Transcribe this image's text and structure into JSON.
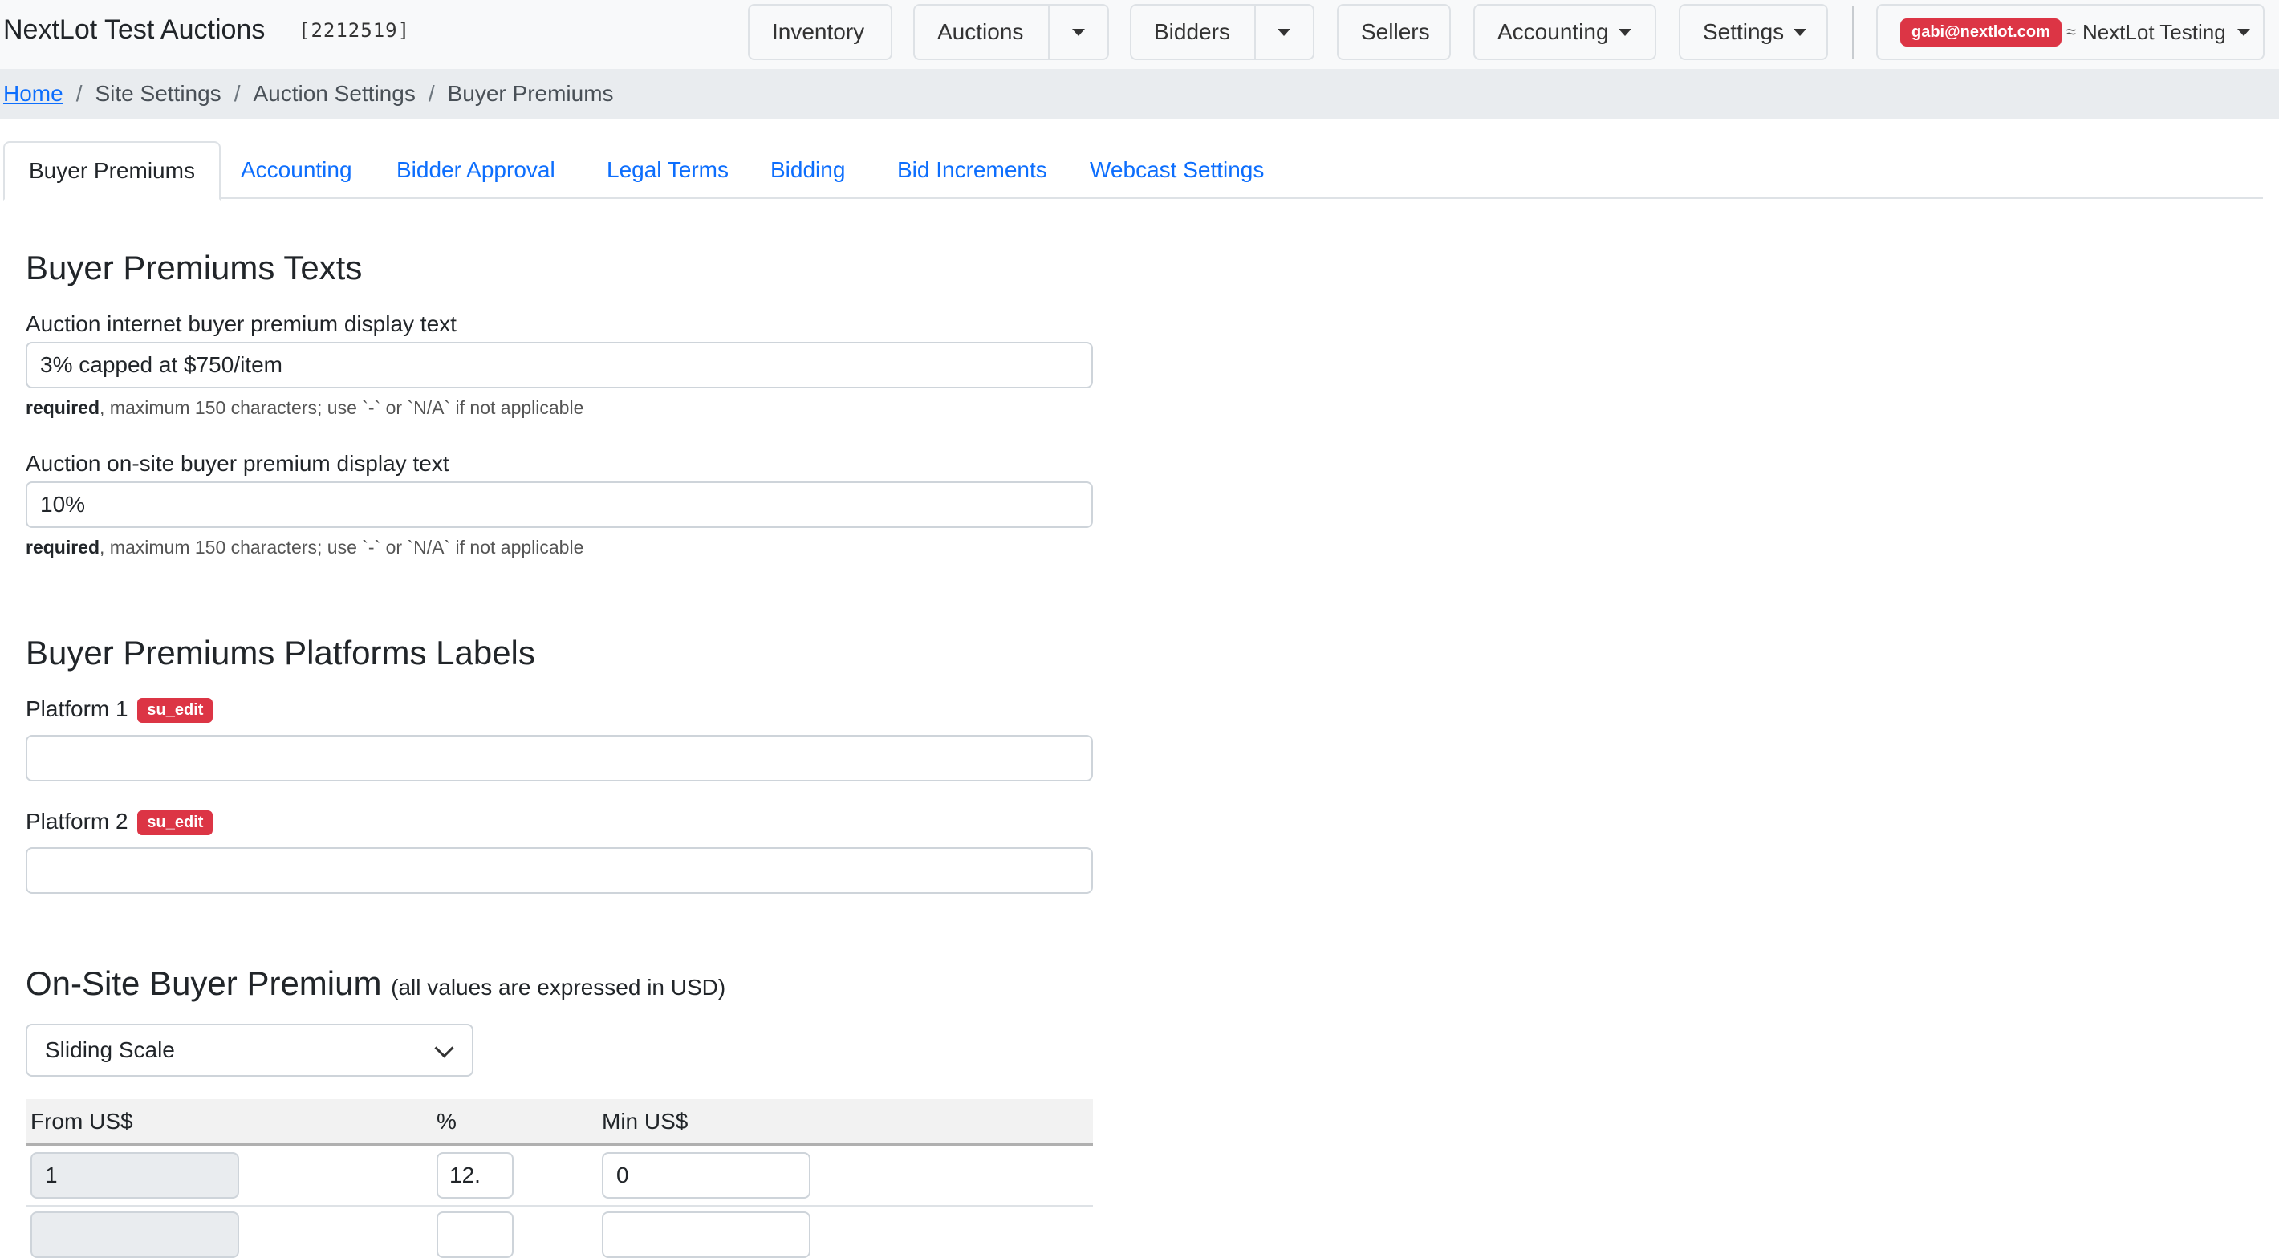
{
  "navbar": {
    "brand": "NextLot Test Auctions",
    "site_id": "[2212519]",
    "inventory": "Inventory",
    "auctions": "Auctions",
    "bidders": "Bidders",
    "sellers": "Sellers",
    "accounting": "Accounting",
    "settings": "Settings",
    "user_email": "gabi@nextlot.com",
    "user_separator": "≈",
    "account_name": "NextLot Testing"
  },
  "breadcrumb": {
    "home": "Home",
    "site_settings": "Site Settings",
    "auction_settings": "Auction Settings",
    "current": "Buyer Premiums",
    "separator": "/"
  },
  "tabs": [
    {
      "label": "Buyer Premiums"
    },
    {
      "label": "Accounting"
    },
    {
      "label": "Bidder Approval"
    },
    {
      "label": "Legal Terms"
    },
    {
      "label": "Bidding"
    },
    {
      "label": "Bid Increments"
    },
    {
      "label": "Webcast Settings"
    }
  ],
  "texts_section": {
    "title": "Buyer Premiums Texts",
    "internet_label": "Auction internet buyer premium display text",
    "internet_value": "3% capped at $750/item",
    "internet_help_required": "required",
    "internet_help_rest": ", maximum 150 characters; use `-` or `N/A` if not applicable",
    "onsite_label": "Auction on-site buyer premium display text",
    "onsite_value": "10%",
    "onsite_help_required": "required",
    "onsite_help_rest": ", maximum 150 characters; use `-` or `N/A` if not applicable"
  },
  "platforms_section": {
    "title": "Buyer Premiums Platforms Labels",
    "platform1_label": "Platform 1",
    "platform1_badge": "su_edit",
    "platform1_value": "",
    "platform2_label": "Platform 2",
    "platform2_badge": "su_edit",
    "platform2_value": ""
  },
  "onsite_premium": {
    "title": "On-Site Buyer Premium",
    "subtitle": "(all values are expressed in USD)",
    "scale_type": "Sliding Scale",
    "columns": {
      "from": "From US$",
      "percent": "%",
      "min": "Min US$"
    },
    "rows": [
      {
        "from": "1",
        "percent": "12.",
        "min": "0"
      }
    ]
  },
  "colors": {
    "accent": "#0d6efd",
    "danger": "#dc3545"
  }
}
